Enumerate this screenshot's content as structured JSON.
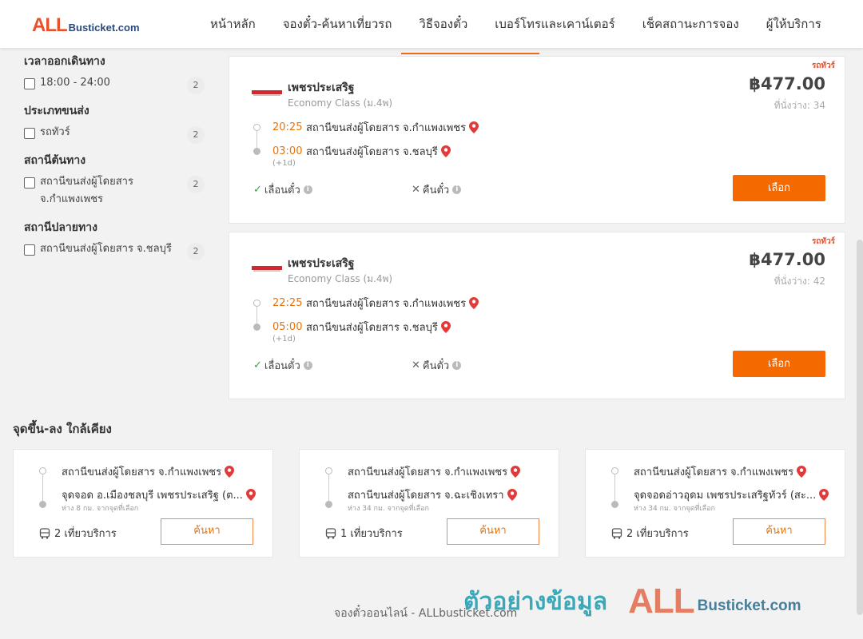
{
  "header": {
    "logo_all": "ALL",
    "logo_rest": "Busticket.com",
    "nav": [
      "หน้าหลัก",
      "จองตั๋ว-ค้นหาเที่ยวรถ",
      "วิธีจองตั๋ว",
      "เบอร์โทรและเคาน์เตอร์",
      "เช็คสถานะการจอง",
      "ผู้ให้บริการ"
    ]
  },
  "filters": {
    "departure_time": {
      "title": "เวลาออกเดินทาง",
      "options": [
        {
          "label": "18:00 - 24:00",
          "count": "2"
        }
      ]
    },
    "transport_type": {
      "title": "ประเภทขนส่ง",
      "options": [
        {
          "label": "รถทัวร์",
          "count": "2"
        }
      ]
    },
    "origin_station": {
      "title": "สถานีต้นทาง",
      "options": [
        {
          "label": "สถานีขนส่งผู้โดยสาร จ.กำแพงเพชร",
          "count": "2"
        }
      ]
    },
    "destination_station": {
      "title": "สถานีปลายทาง",
      "options": [
        {
          "label": "สถานีขนส่งผู้โดยสาร จ.ชลบุรี",
          "count": "2"
        }
      ]
    }
  },
  "results": [
    {
      "bus_type": "รถทัวร์",
      "operator": "เพชรประเสริฐ",
      "class": "Economy Class (ม.4พ)",
      "price": "฿477.00",
      "seats": "ที่นั่งว่าง: 34",
      "depart_time": "20:25",
      "depart_station": "สถานีขนส่งผู้โดยสาร จ.กำแพงเพชร",
      "arrive_time": "03:00",
      "arrive_station": "สถานีขนส่งผู้โดยสาร จ.ชลบุรี",
      "day_offset": "(+1d)",
      "feature_change": "เลื่อนตั๋ว",
      "feature_refund": "คืนตั๋ว",
      "select_label": "เลือก"
    },
    {
      "bus_type": "รถทัวร์",
      "operator": "เพชรประเสริฐ",
      "class": "Economy Class (ม.4พ)",
      "price": "฿477.00",
      "seats": "ที่นั่งว่าง: 42",
      "depart_time": "22:25",
      "depart_station": "สถานีขนส่งผู้โดยสาร จ.กำแพงเพชร",
      "arrive_time": "05:00",
      "arrive_station": "สถานีขนส่งผู้โดยสาร จ.ชลบุรี",
      "day_offset": "(+1d)",
      "feature_change": "เลื่อนตั๋ว",
      "feature_refund": "คืนตั๋ว",
      "select_label": "เลือก"
    }
  ],
  "nearby": {
    "title": "จุดขึ้น-ลง ใกล้เคียง",
    "cards": [
      {
        "from": "สถานีขนส่งผู้โดยสาร จ.กำแพงเพชร",
        "to": "จุดจอด อ.เมืองชลบุรี เพชรประเสริฐ (ต...",
        "distance": "ห่าง 8 กม. จากจุดที่เลือก",
        "trips": "2 เที่ยวบริการ",
        "search_label": "ค้นหา"
      },
      {
        "from": "สถานีขนส่งผู้โดยสาร จ.กำแพงเพชร",
        "to": "สถานีขนส่งผู้โดยสาร จ.ฉะเชิงเทรา",
        "distance": "ห่าง 34 กม. จากจุดที่เลือก",
        "trips": "1 เที่ยวบริการ",
        "search_label": "ค้นหา"
      },
      {
        "from": "สถานีขนส่งผู้โดยสาร จ.กำแพงเพชร",
        "to": "จุดจอดอ่าวอุดม เพชรประเสริฐทัวร์ (สะ...",
        "distance": "ห่าง 34 กม. จากจุดที่เลือก",
        "trips": "2 เที่ยวบริการ",
        "search_label": "ค้นหา"
      }
    ]
  },
  "footer": {
    "text": "จองตั๋วออนไลน์ - ALLbusticket.com"
  },
  "watermark": {
    "thai": "ตัวอย่างข้อมูล",
    "all": "ALL",
    "rest": "Busticket.com"
  },
  "colors": {
    "accent": "#f56a00",
    "time": "#e8730b",
    "pin": "#e2393a",
    "check": "#3aa43a"
  }
}
